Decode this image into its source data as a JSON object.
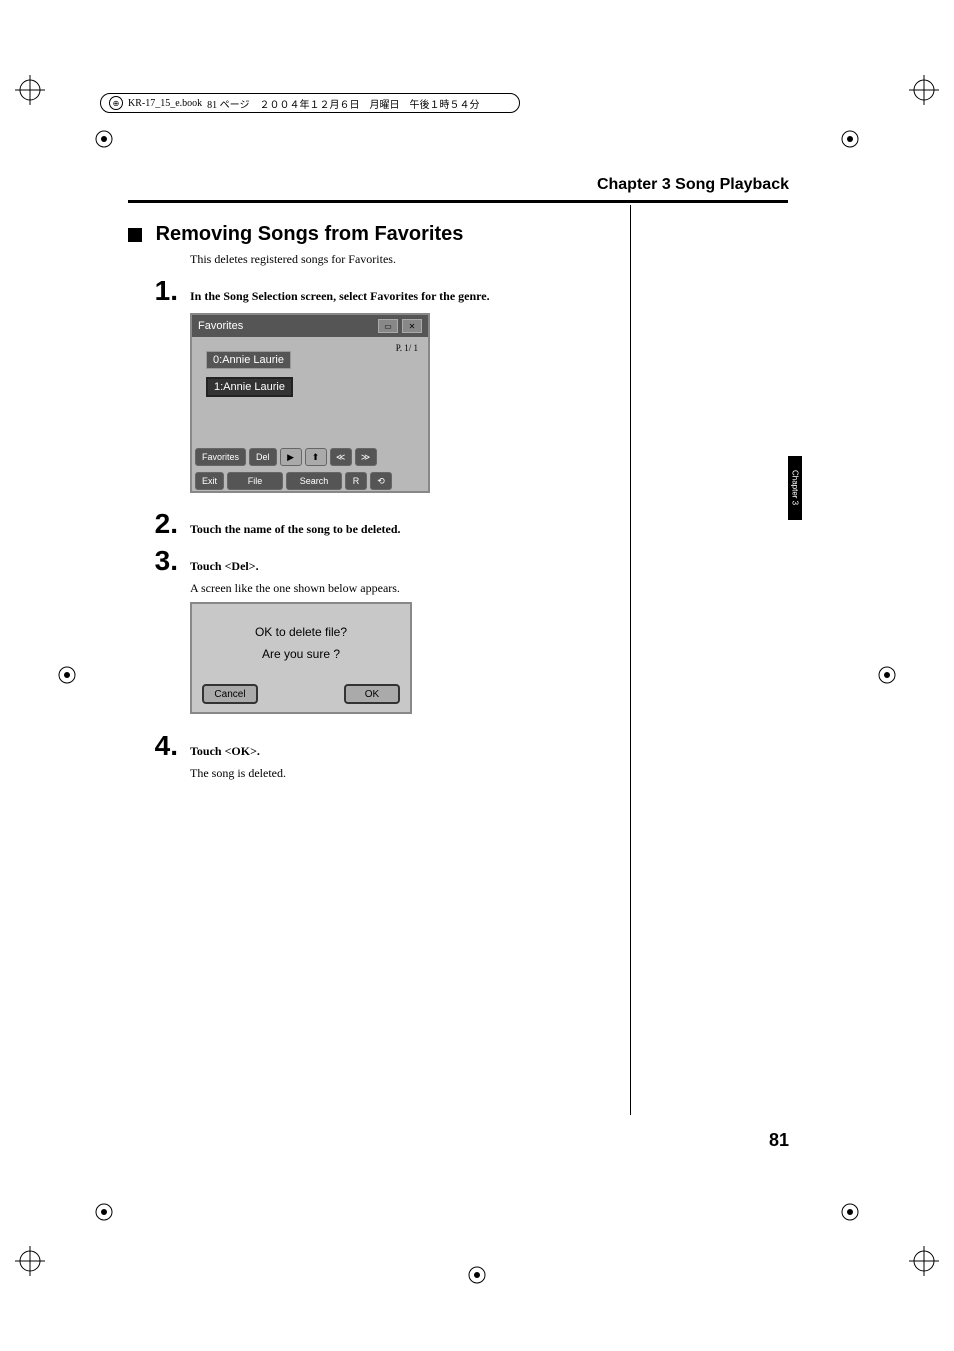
{
  "header": {
    "filename": "KR-17_15_e.book",
    "page_info": "81 ページ　２００４年１２月６日　月曜日　午後１時５４分"
  },
  "chapter": {
    "title": "Chapter 3 Song Playback",
    "tab_label": "Chapter 3"
  },
  "section": {
    "heading": "Removing Songs from Favorites",
    "intro": "This deletes registered songs for Favorites."
  },
  "steps": [
    {
      "num": "1.",
      "text": "In the Song Selection screen, select Favorites for the genre."
    },
    {
      "num": "2.",
      "text": "Touch the name of the song to be deleted."
    },
    {
      "num": "3.",
      "text": "Touch <Del>.",
      "sub": "A screen like the one shown below appears."
    },
    {
      "num": "4.",
      "text": "Touch <OK>.",
      "sub": "The song is deleted."
    }
  ],
  "screenshot1": {
    "title": "Favorites",
    "page": "P. 1/ 1",
    "songs": [
      "0:Annie Laurie",
      "1:Annie Laurie"
    ],
    "toolbar_row1": [
      "Favorites",
      "Del",
      "▶",
      "⬆",
      "≪",
      "≫"
    ],
    "toolbar_row2": [
      "Exit",
      "File",
      "Search",
      "R",
      "⟲"
    ]
  },
  "screenshot2": {
    "line1": "OK to delete file?",
    "line2": "Are you sure ?",
    "cancel": "Cancel",
    "ok": "OK"
  },
  "page_number": "81"
}
